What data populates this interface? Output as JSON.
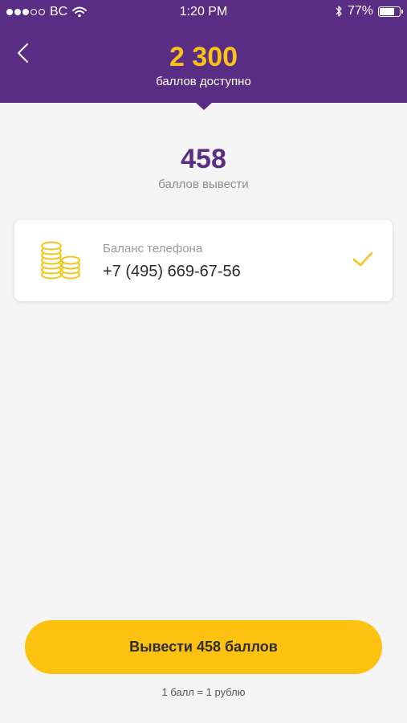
{
  "status_bar": {
    "carrier": "BC",
    "time": "1:20 PM",
    "battery_percent_label": "77%",
    "battery_level": 0.77,
    "signal_filled": 3,
    "signal_total": 5
  },
  "header": {
    "points_available": "2 300",
    "points_available_caption": "баллов доступно"
  },
  "withdraw": {
    "amount": "458",
    "amount_caption": "баллов вывести"
  },
  "payout_method": {
    "label": "Баланс телефона",
    "phone": "+7 (495) 669-67-56",
    "selected": true
  },
  "actions": {
    "withdraw_button_label": "Вывести 458 баллов"
  },
  "footer": {
    "rate_note": "1 балл = 1 рублю"
  },
  "colors": {
    "header_bg": "#5a2d84",
    "accent_yellow": "#fdc20f",
    "amount_purple": "#5a2d84",
    "page_bg": "#f4f4f4"
  },
  "icons": {
    "back": "chevron-left-icon",
    "coins": "coin-stacks-icon",
    "check": "checkmark-icon",
    "wifi": "wifi-icon",
    "bluetooth": "bluetooth-icon",
    "battery": "battery-icon"
  }
}
